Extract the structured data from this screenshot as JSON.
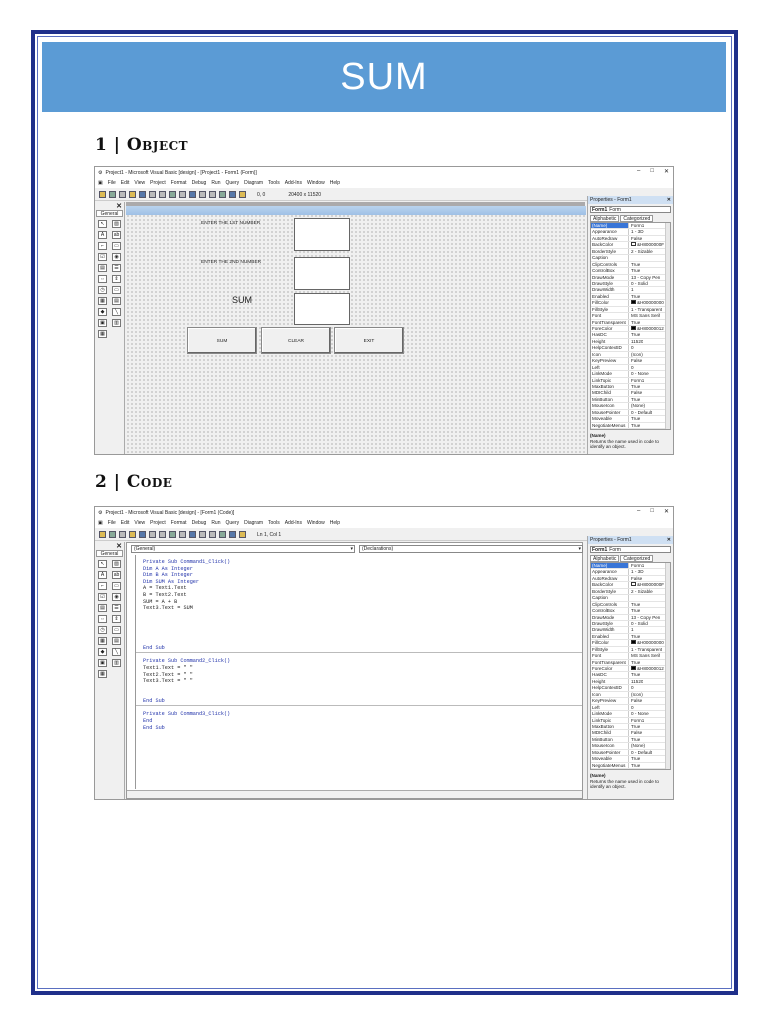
{
  "page": {
    "title": "SUM",
    "section1": "1 | Object",
    "section2": "2 | Code"
  },
  "colors": {
    "banner": "#5b9bd5",
    "frame": "#1f2f8a",
    "keyword": "#2233aa"
  },
  "ide": {
    "title_design": "Project1 - Microsoft Visual Basic [design] - [Project1 - Form1 (Form)]",
    "title_code": "Project1 - Microsoft Visual Basic [design] - [Form1 (Code)]",
    "window_controls": [
      "–",
      "□",
      "✕"
    ],
    "menu": [
      "File",
      "Edit",
      "View",
      "Project",
      "Format",
      "Debug",
      "Run",
      "Query",
      "Diagram",
      "Tools",
      "Add-Ins",
      "Window",
      "Help"
    ],
    "toolbar_position": "0, 0",
    "toolbar_size": "20400 x 11520",
    "toolbar_cursor": "Ln 1, Col 1",
    "toolbox_tab": "General",
    "toolbox_close": "✕"
  },
  "form": {
    "label1": "ENTER THE 1ST NUMBER",
    "label2": "ENTER THE 2ND NUMBER",
    "label3": "SUM",
    "buttons": [
      "SUM",
      "CLEAR",
      "EXIT"
    ]
  },
  "code": {
    "object_combo": "(General)",
    "proc_combo": "(Declarations)",
    "blocks": [
      [
        "Private Sub Command1_Click()",
        "Dim A As Integer",
        "Dim B As Integer",
        "Dim SUM As Integer",
        "A = Text1.Text",
        "B = Text2.Text",
        "SUM = A + B",
        "Text3.Text = SUM",
        "",
        "",
        "",
        "",
        "",
        "End Sub"
      ],
      [
        "Private Sub Command2_Click()",
        "Text1.Text = \" \"",
        "Text2.Text = \" \"",
        "Text3.Text = \" \"",
        "",
        "",
        "End Sub"
      ],
      [
        "Private Sub Command3_Click()",
        "End",
        "End Sub"
      ]
    ]
  },
  "properties": {
    "header": "Properties - Form1",
    "object": "Form1",
    "object_type": "Form",
    "tabs": [
      "Alphabetic",
      "Categorized"
    ],
    "rows": [
      [
        "(Name)",
        "Form1"
      ],
      [
        "Appearance",
        "1 - 3D"
      ],
      [
        "AutoRedraw",
        "False"
      ],
      [
        "BackColor",
        "&H8000000F"
      ],
      [
        "BorderStyle",
        "2 - Sizable"
      ],
      [
        "Caption",
        ""
      ],
      [
        "ClipControls",
        "True"
      ],
      [
        "ControlBox",
        "True"
      ],
      [
        "DrawMode",
        "13 - Copy Pen"
      ],
      [
        "DrawStyle",
        "0 - Solid"
      ],
      [
        "DrawWidth",
        "1"
      ],
      [
        "Enabled",
        "True"
      ],
      [
        "FillColor",
        "&H00000000"
      ],
      [
        "FillStyle",
        "1 - Transparent"
      ],
      [
        "Font",
        "MS Sans Serif"
      ],
      [
        "FontTransparent",
        "True"
      ],
      [
        "ForeColor",
        "&H80000012"
      ],
      [
        "HasDC",
        "True"
      ],
      [
        "Height",
        "11520"
      ],
      [
        "HelpContextID",
        "0"
      ],
      [
        "Icon",
        "(Icon)"
      ],
      [
        "KeyPreview",
        "False"
      ],
      [
        "Left",
        "0"
      ],
      [
        "LinkMode",
        "0 - None"
      ],
      [
        "LinkTopic",
        "Form1"
      ],
      [
        "MaxButton",
        "True"
      ],
      [
        "MDIChild",
        "False"
      ],
      [
        "MinButton",
        "True"
      ],
      [
        "MouseIcon",
        "(None)"
      ],
      [
        "MousePointer",
        "0 - Default"
      ],
      [
        "Moveable",
        "True"
      ],
      [
        "NegotiateMenus",
        "True"
      ]
    ],
    "desc_title": "(Name)",
    "desc_text": "Returns the name used in code to identify an object."
  }
}
